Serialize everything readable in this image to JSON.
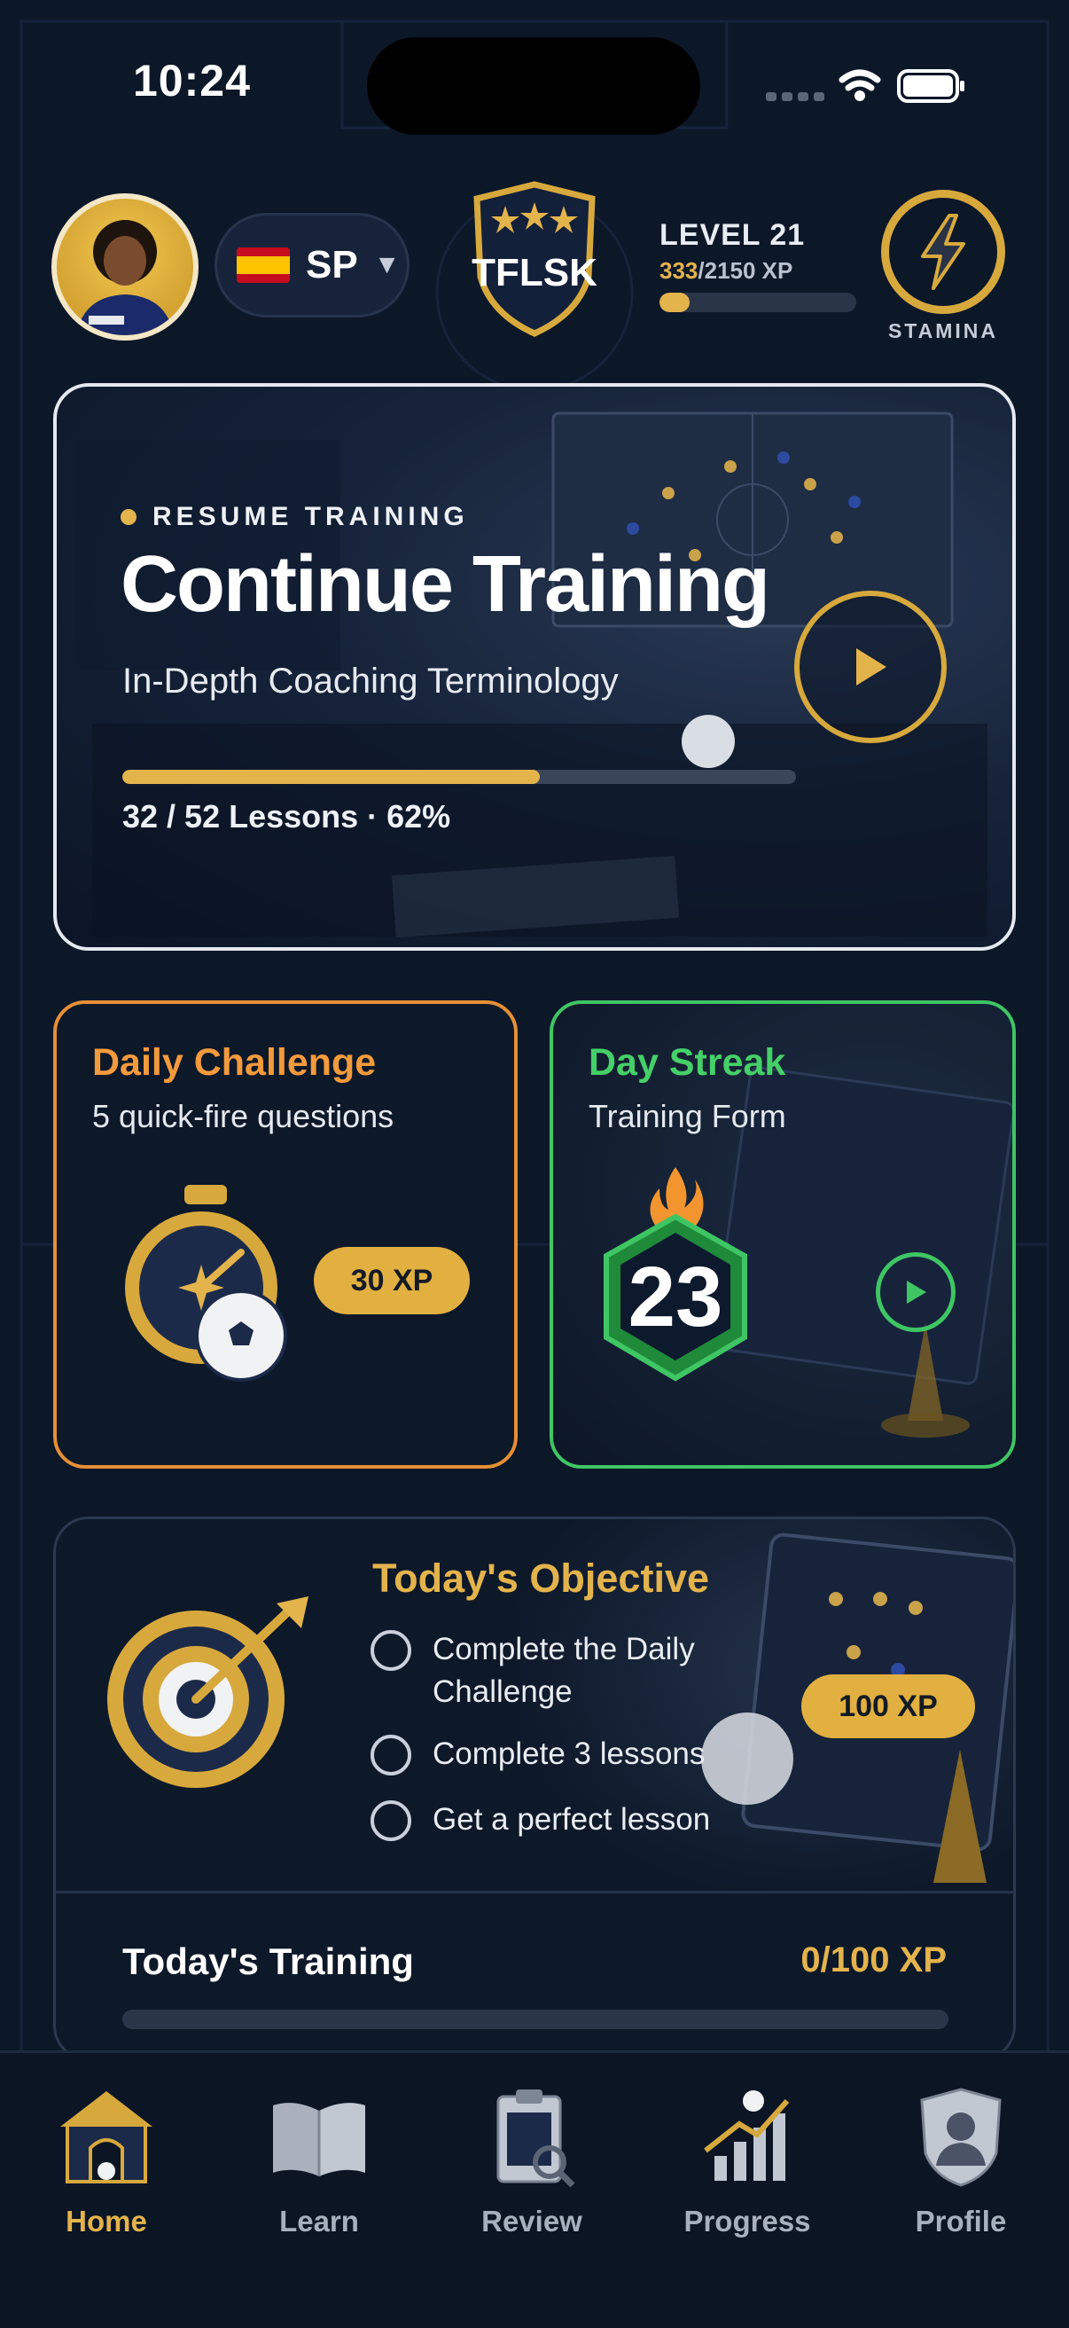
{
  "status_bar": {
    "time": "10:24"
  },
  "header": {
    "language_code": "SP",
    "badge_text": "TFLSK",
    "level_label": "LEVEL 21",
    "xp_current": "333",
    "xp_total": "/2150 XP",
    "level_progress_fraction": 0.155,
    "stamina_label": "STAMINA"
  },
  "hero": {
    "eyebrow": "RESUME TRAINING",
    "title": "Continue Training",
    "subtitle": "In-Depth Coaching Terminology",
    "progress_text": "32 / 52 Lessons · 62%",
    "progress_percent": 62
  },
  "daily_challenge": {
    "title": "Daily Challenge",
    "subtitle": "5 quick-fire questions",
    "xp": "30 XP"
  },
  "streak": {
    "title": "Day Streak",
    "subtitle": "Training Form",
    "count": "23"
  },
  "objective": {
    "title": "Today's Objective",
    "items": [
      {
        "label": "Complete the Daily Challenge",
        "line1": "Complete the Daily",
        "line2": "Challenge"
      },
      {
        "label": "Complete 3 lessons"
      },
      {
        "label": "Get a perfect lesson"
      }
    ],
    "xp": "100 XP",
    "training_label": "Today's Training",
    "training_xp": "0/100 XP",
    "training_progress_percent": 0
  },
  "nav": {
    "items": [
      {
        "label": "Home",
        "icon": "home-icon",
        "active": true
      },
      {
        "label": "Learn",
        "icon": "book-icon",
        "active": false
      },
      {
        "label": "Review",
        "icon": "clipboard-icon",
        "active": false
      },
      {
        "label": "Progress",
        "icon": "chart-icon",
        "active": false
      },
      {
        "label": "Profile",
        "icon": "profile-icon",
        "active": false
      }
    ]
  },
  "colors": {
    "gold": "#e3b34c",
    "orange": "#f39a3c",
    "green": "#45cf68",
    "background": "#0c1728"
  }
}
